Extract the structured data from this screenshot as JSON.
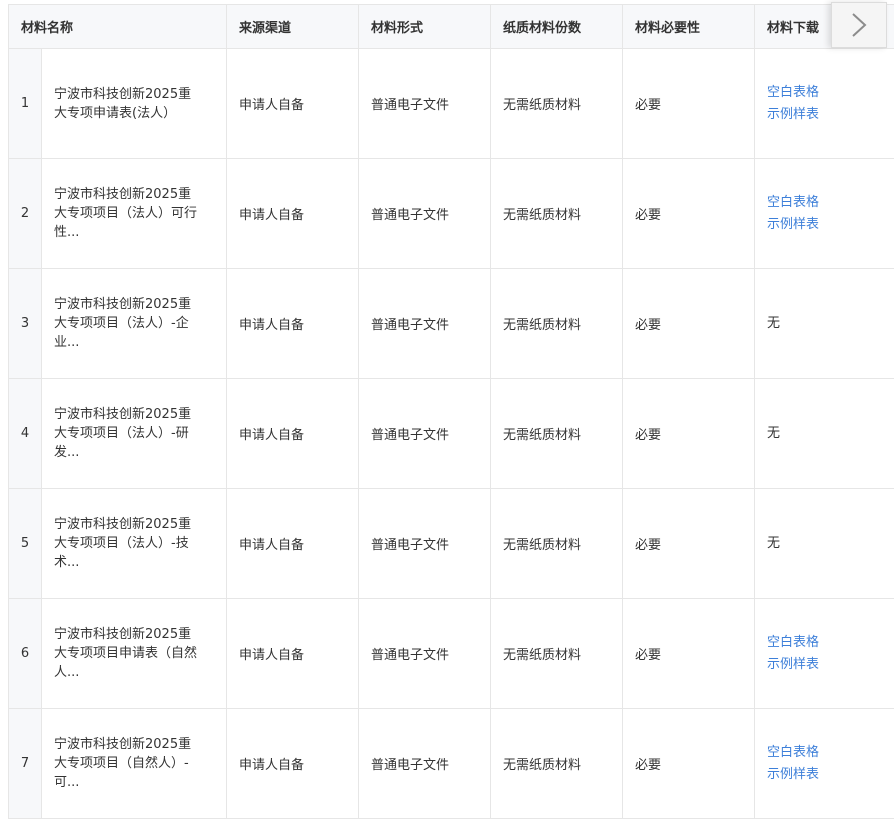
{
  "table": {
    "headers": {
      "name": "材料名称",
      "source": "来源渠道",
      "form": "材料形式",
      "paper": "纸质材料份数",
      "required": "材料必要性",
      "download": "材料下载"
    },
    "rows": [
      {
        "index": "1",
        "name_line1": "宁波市科技创新2025重",
        "name_line2": "大专项申请表(法人）",
        "name_line3": "",
        "source": "申请人自备",
        "form": "普通电子文件",
        "paper": "无需纸质材料",
        "required": "必要",
        "download_blank": "空白表格",
        "download_sample": "示例样表",
        "download_none": ""
      },
      {
        "index": "2",
        "name_line1": "宁波市科技创新2025重",
        "name_line2": "大专项项目（法人）可行",
        "name_line3": "性...",
        "source": "申请人自备",
        "form": "普通电子文件",
        "paper": "无需纸质材料",
        "required": "必要",
        "download_blank": "空白表格",
        "download_sample": "示例样表",
        "download_none": ""
      },
      {
        "index": "3",
        "name_line1": "宁波市科技创新2025重",
        "name_line2": "大专项项目（法人）-企",
        "name_line3": "业...",
        "source": "申请人自备",
        "form": "普通电子文件",
        "paper": "无需纸质材料",
        "required": "必要",
        "download_blank": "",
        "download_sample": "",
        "download_none": "无"
      },
      {
        "index": "4",
        "name_line1": "宁波市科技创新2025重",
        "name_line2": "大专项项目（法人）-研",
        "name_line3": "发...",
        "source": "申请人自备",
        "form": "普通电子文件",
        "paper": "无需纸质材料",
        "required": "必要",
        "download_blank": "",
        "download_sample": "",
        "download_none": "无"
      },
      {
        "index": "5",
        "name_line1": "宁波市科技创新2025重",
        "name_line2": "大专项项目（法人）-技",
        "name_line3": "术...",
        "source": "申请人自备",
        "form": "普通电子文件",
        "paper": "无需纸质材料",
        "required": "必要",
        "download_blank": "",
        "download_sample": "",
        "download_none": "无"
      },
      {
        "index": "6",
        "name_line1": "宁波市科技创新2025重",
        "name_line2": "大专项项目申请表（自然",
        "name_line3": "人...",
        "source": "申请人自备",
        "form": "普通电子文件",
        "paper": "无需纸质材料",
        "required": "必要",
        "download_blank": "空白表格",
        "download_sample": "示例样表",
        "download_none": ""
      },
      {
        "index": "7",
        "name_line1": "宁波市科技创新2025重",
        "name_line2": "大专项项目（自然人）-",
        "name_line3": "可...",
        "source": "申请人自备",
        "form": "普通电子文件",
        "paper": "无需纸质材料",
        "required": "必要",
        "download_blank": "空白表格",
        "download_sample": "示例样表",
        "download_none": ""
      }
    ]
  },
  "scroll_right": {
    "icon": "chevron-right-icon"
  }
}
